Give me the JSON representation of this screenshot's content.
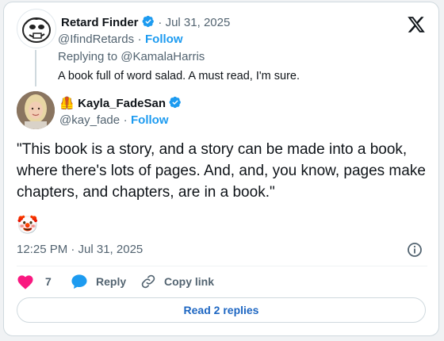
{
  "quoted": {
    "name": "Retard Finder",
    "date": "· Jul 31, 2025",
    "handle": "@IfindRetards",
    "sep": "·",
    "follow": "Follow",
    "replying_prefix": "Replying to ",
    "replying_to": "@KamalaHarris",
    "text": "A book full of word salad. A must read, I'm sure."
  },
  "main": {
    "name_emoji": "🦺",
    "name": "Kayla_FadeSan",
    "handle": "@kay_fade",
    "sep": "·",
    "follow": "Follow",
    "text": "\"This book is a story, and a story can be made into a book, where there's lots of pages. And, and, you know, pages make chapters, and chapters, are in a book.\"",
    "emoji": "🤡",
    "timestamp": "12:25 PM · Jul 31, 2025"
  },
  "actions": {
    "like_count": "7",
    "reply_label": "Reply",
    "copy_label": "Copy link"
  },
  "read_replies": "Read 2 replies",
  "colors": {
    "accent": "#1d9bf0",
    "like": "#f91880",
    "text": "#0f1419",
    "muted": "#536471"
  },
  "icons": [
    "x-logo-icon",
    "verified-badge-icon",
    "info-icon",
    "heart-icon",
    "reply-icon",
    "link-icon"
  ]
}
